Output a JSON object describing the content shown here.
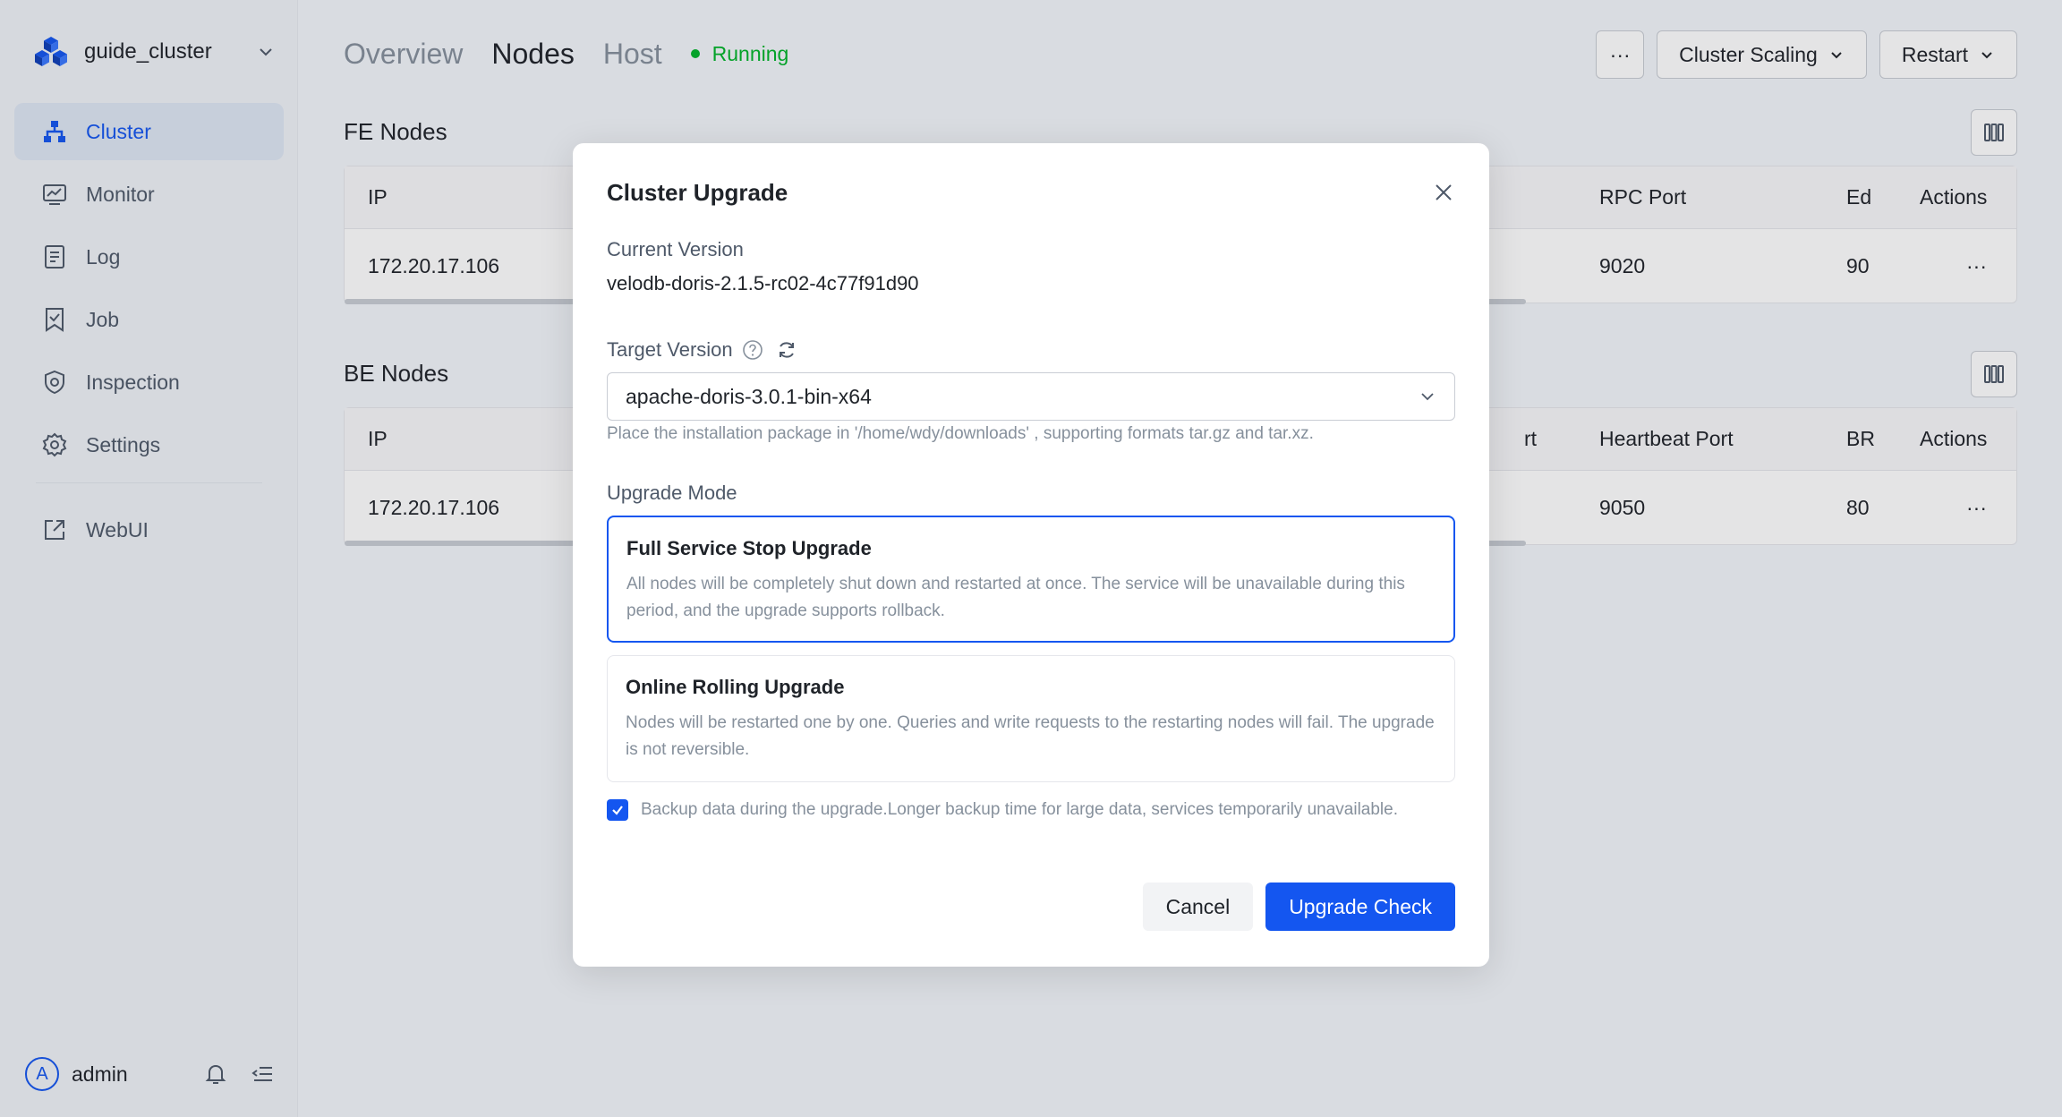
{
  "sidebar": {
    "cluster_name": "guide_cluster",
    "items": [
      {
        "label": "Cluster",
        "icon": "cluster-icon"
      },
      {
        "label": "Monitor",
        "icon": "monitor-icon"
      },
      {
        "label": "Log",
        "icon": "log-icon"
      },
      {
        "label": "Job",
        "icon": "job-icon"
      },
      {
        "label": "Inspection",
        "icon": "shield-icon"
      },
      {
        "label": "Settings",
        "icon": "gear-icon"
      },
      {
        "label": "WebUI",
        "icon": "external-link-icon"
      }
    ],
    "user": {
      "initial": "A",
      "name": "admin"
    }
  },
  "header": {
    "tabs": [
      "Overview",
      "Nodes",
      "Host"
    ],
    "active_tab": "Nodes",
    "status": "Running",
    "more_label": "···",
    "scaling_label": "Cluster Scaling",
    "restart_label": "Restart"
  },
  "fe": {
    "title": "FE Nodes",
    "headers": {
      "ip": "IP",
      "rpc": "RPC Port",
      "ed": "Ed",
      "actions": "Actions"
    },
    "row": {
      "ip": "172.20.17.106",
      "rpc": "9020",
      "ed": "90",
      "actions": "···"
    }
  },
  "be": {
    "title": "BE Nodes",
    "headers": {
      "ip": "IP",
      "partial": "rt",
      "heartbeat": "Heartbeat Port",
      "br": "BR",
      "actions": "Actions"
    },
    "row": {
      "ip": "172.20.17.106",
      "heartbeat": "9050",
      "br": "80",
      "actions": "···"
    }
  },
  "modal": {
    "title": "Cluster Upgrade",
    "current_version_label": "Current Version",
    "current_version": "velodb-doris-2.1.5-rc02-4c77f91d90",
    "target_version_label": "Target Version",
    "target_version": "apache-doris-3.0.1-bin-x64",
    "hint": "Place the installation package in '/home/wdy/downloads' , supporting formats tar.gz and tar.xz.",
    "mode_label": "Upgrade Mode",
    "modes": [
      {
        "title": "Full Service Stop Upgrade",
        "desc": "All nodes will be completely shut down and restarted at once. The service will be unavailable during this period, and the upgrade supports rollback."
      },
      {
        "title": "Online Rolling Upgrade",
        "desc": "Nodes will be restarted one by one. Queries and write requests to the restarting nodes will fail. The upgrade is not reversible."
      }
    ],
    "selected_mode": "Full Service Stop Upgrade",
    "backup_text": "Backup data during the upgrade.Longer backup time for large data, services temporarily unavailable.",
    "backup_checked": true,
    "cancel_label": "Cancel",
    "confirm_label": "Upgrade Check"
  },
  "colors": {
    "primary": "#1456f0",
    "success": "#00b42a"
  }
}
